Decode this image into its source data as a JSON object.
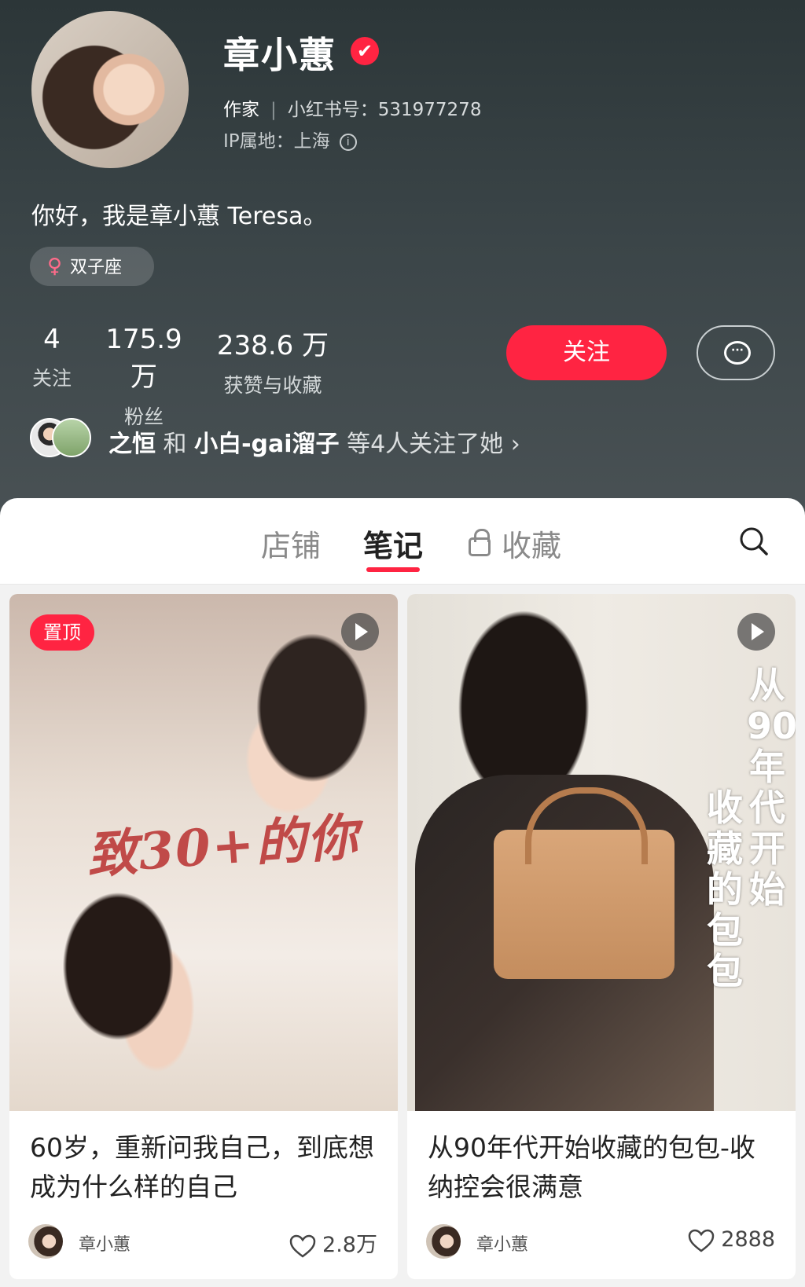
{
  "profile": {
    "name": "章小蕙",
    "verified_mark": "✔",
    "role": "作家",
    "id_label": "小红书号：",
    "id_value": "531977278",
    "ip_label": "IP属地：",
    "ip_value": "上海",
    "info_icon": "ⓘ",
    "bio": "你好，我是章小蕙 Teresa。",
    "tag": "双子座",
    "tag_icon": "♀"
  },
  "stats": [
    {
      "value": "4",
      "label": "关注"
    },
    {
      "value": "175.9 万",
      "label": "粉丝"
    },
    {
      "value": "238.6 万",
      "label": "获赞与收藏"
    }
  ],
  "actions": {
    "follow_label": "关注",
    "message_icon": "chat-bubble-icon",
    "message_dots": "···"
  },
  "mutual": {
    "name1": "之恒",
    "joiner": " 和 ",
    "name2": "小白-gai溜子",
    "suffix": " 等4人关注了她 ",
    "chevron": "›"
  },
  "tabs": [
    {
      "label": "店铺"
    },
    {
      "label": "笔记"
    },
    {
      "label": "收藏"
    }
  ],
  "posts": [
    {
      "pin": "置顶",
      "overlay": "致30+的你",
      "title": "60岁，重新问我自己，到底想成为什么样的自己",
      "author": "章小蕙",
      "likes": "2.8万"
    },
    {
      "overlay_col1": "从90年代开始",
      "overlay_col2": "收藏的包包",
      "title": "从90年代开始收藏的包包-收纳控会很满意",
      "author": "章小蕙",
      "likes": "2888"
    }
  ],
  "colors": {
    "accent": "#ff2442",
    "header_bg": "#3b4548"
  }
}
